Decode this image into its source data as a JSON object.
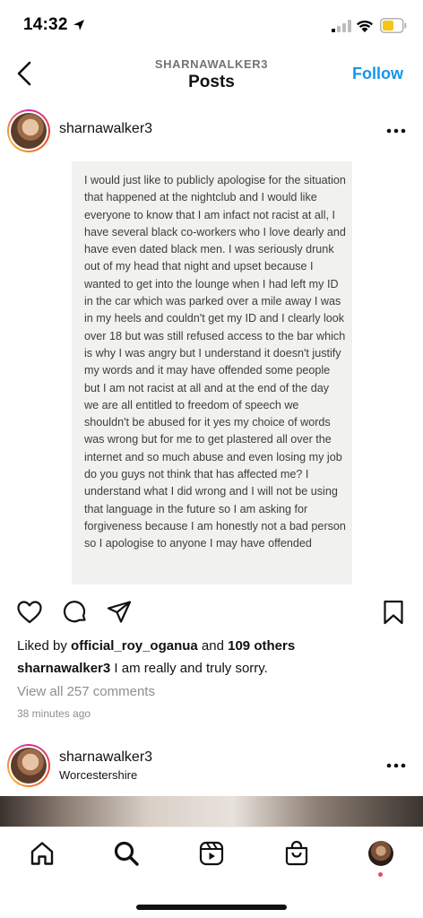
{
  "status_bar": {
    "time": "14:32",
    "icons": [
      "location-arrow-icon",
      "signal-icon",
      "wifi-icon",
      "battery-icon"
    ],
    "battery_color": "#f5c518"
  },
  "header": {
    "subtitle": "SHARNAWALKER3",
    "title": "Posts",
    "follow_label": "Follow",
    "accent_color": "#1595ec"
  },
  "post": {
    "username": "sharnawalker3",
    "note_text": "I would just like to publicly apologise for the situation that happened at the nightclub and I would like everyone to know that I am infact not racist at all, I have several black co-workers who I love dearly and have even dated black men. I was seriously drunk out of my head that night and upset because I wanted to get into the lounge when I had left my ID in the car which was parked over a mile away I was in my heels and couldn't get my ID and I clearly look over 18 but was still refused access to the bar which is why I was angry but I understand it doesn't justify my words and it may have offended some people but I am not racist at all and at the end of the day we are all entitled to freedom of speech we shouldn't be abused for it yes my choice of words was wrong but for me to get plastered all over the internet and so much abuse and even losing my job do you guys not think that has affected me? I understand what I did wrong and I will not be using that language in the future so I am asking for forgiveness because I am honestly not a bad person so I apologise to anyone I may have offended",
    "likes_prefix": "Liked by",
    "likes_user": "official_roy_oganua",
    "likes_and": "and",
    "likes_others": "109 others",
    "caption_user": "sharnawalker3",
    "caption_text": "I am really and truly sorry.",
    "view_comments": "View all 257 comments",
    "time_ago": "38 minutes ago"
  },
  "post2": {
    "username": "sharnawalker3",
    "location": "Worcestershire"
  },
  "bottom_nav": {
    "items": [
      "home-icon",
      "search-icon",
      "reels-icon",
      "shop-icon",
      "profile-avatar"
    ],
    "notification_color": "#ed4956"
  }
}
